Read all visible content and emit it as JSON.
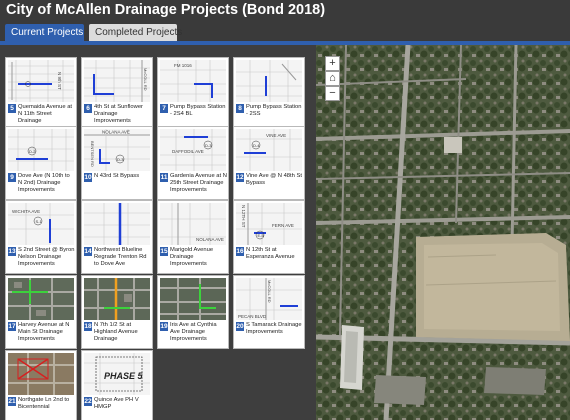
{
  "app": {
    "title": "City of McAllen Drainage Projects (Bond 2018)"
  },
  "tabs": [
    {
      "label": "Current Projects",
      "active": true
    },
    {
      "label": "Completed Projects",
      "active": false
    }
  ],
  "colors": {
    "accent": "#2f5fae",
    "header_bg": "#3a3a3a",
    "gallery_bg": "#3e3e3e"
  },
  "projects": [
    {
      "number": "5",
      "title": "Quemaida Avenue at N 11th Street Drainage Improvements",
      "thumb_labels": [
        "N 9th ST"
      ]
    },
    {
      "number": "6",
      "title": "4th St at Sunflower Drainage Improvements",
      "thumb_labels": [
        "McCOLL RD"
      ]
    },
    {
      "number": "7",
      "title": "Pump Bypass Station - 2S4 BL",
      "thumb_labels": [
        "FM 1016"
      ]
    },
    {
      "number": "8",
      "title": "Pump Bypass Station - 2SS",
      "thumb_labels": []
    },
    {
      "number": "9",
      "title": "Dove Ave (N 10th to N 2nd) Drainage Improvements",
      "thumb_labels": [
        "D-2"
      ]
    },
    {
      "number": "10",
      "title": "N 43rd St Bypass",
      "thumb_labels": [
        "NOLANA AVE",
        "BENTSEN RD",
        "D-3"
      ]
    },
    {
      "number": "11",
      "title": "Gardenia Avenue at N 25th Street Drainage Improvements",
      "thumb_labels": [
        "D-3",
        "DAFFODIL AVE"
      ]
    },
    {
      "number": "12",
      "title": "Vine Ave @ N 48th St Bypass",
      "thumb_labels": [
        "VINE AVE",
        "D-4"
      ]
    },
    {
      "number": "13",
      "title": "S 2nd Street @ Byron Nelson Drainage Improvements",
      "thumb_labels": [
        "WICHITA AVE",
        "S-1"
      ]
    },
    {
      "number": "14",
      "title": "Northwest Blueline Regrade Trenton Rd to Dove Ave",
      "thumb_labels": []
    },
    {
      "number": "15",
      "title": "Marigold Avenue Drainage Improvements",
      "thumb_labels": [
        "NOLANA AVE"
      ]
    },
    {
      "number": "16",
      "title": "N 12th St at Esperanza Avenue",
      "thumb_labels": [
        "N 12TH ST",
        "FERN AVE",
        "E-5"
      ]
    },
    {
      "number": "17",
      "title": "Harvey Avenue at N Main St Drainage Improvements",
      "thumb_labels": []
    },
    {
      "number": "18",
      "title": "N 7th 1/2 St at Highland Avenue Drainage Improvements",
      "thumb_labels": []
    },
    {
      "number": "19",
      "title": "Iris Ave at Cynthia Ave Drainage Improvements",
      "thumb_labels": []
    },
    {
      "number": "20",
      "title": "S Tamarack Drainage Improvements",
      "thumb_labels": [
        "McCOLL RD",
        "PECAN BLVD"
      ]
    },
    {
      "number": "21",
      "title": "Northgate Ln 2nd to Bicentennial",
      "thumb_labels": []
    },
    {
      "number": "22",
      "title": "Quince Ave PH V HMGP",
      "thumb_labels": [
        "PHASE 5"
      ]
    }
  ],
  "map": {
    "zoom_in": "+",
    "home": "⌂",
    "zoom_out": "−"
  }
}
